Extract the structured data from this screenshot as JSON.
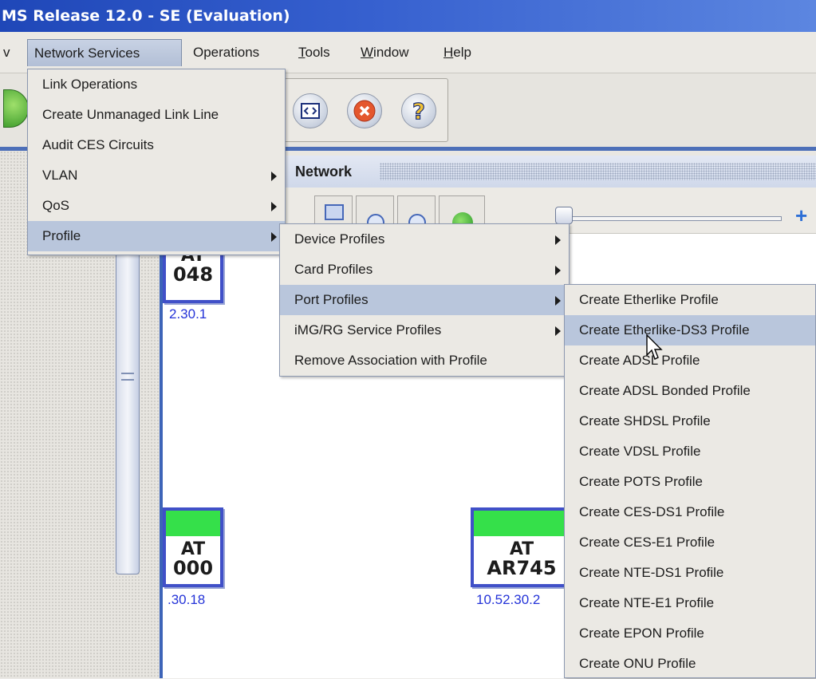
{
  "window": {
    "title": "MS Release 12.0 - SE (Evaluation)"
  },
  "menubar": {
    "items": [
      {
        "label": "v"
      },
      {
        "label": "Network Services"
      },
      {
        "label": "Operations"
      },
      {
        "label": "Tools"
      },
      {
        "label": "Window"
      },
      {
        "label": "Help"
      }
    ]
  },
  "network_panel": {
    "title": "Network"
  },
  "devices": [
    {
      "line1": "AT",
      "line2": "048",
      "ip": "2.30.1"
    },
    {
      "line1": "AT",
      "line2": "000",
      "ip": ".30.18"
    },
    {
      "line1": "AT",
      "line2": "AR745",
      "ip": "10.52.30.2"
    }
  ],
  "network_services_menu": {
    "items": [
      {
        "label": "Link Operations",
        "submenu": false
      },
      {
        "label": "Create Unmanaged Link Line",
        "submenu": false
      },
      {
        "label": "Audit CES Circuits",
        "submenu": false
      },
      {
        "label": "VLAN",
        "submenu": true
      },
      {
        "label": "QoS",
        "submenu": true
      },
      {
        "label": "Profile",
        "submenu": true,
        "selected": true
      }
    ]
  },
  "profile_menu": {
    "items": [
      {
        "label": "Device Profiles",
        "submenu": true
      },
      {
        "label": "Card Profiles",
        "submenu": true
      },
      {
        "label": "Port Profiles",
        "submenu": true,
        "selected": true
      },
      {
        "label": "iMG/RG Service Profiles",
        "submenu": true
      },
      {
        "label": "Remove Association with Profile",
        "submenu": false
      }
    ]
  },
  "port_profiles_menu": {
    "items": [
      {
        "label": "Create Etherlike Profile"
      },
      {
        "label": "Create Etherlike-DS3 Profile",
        "selected": true
      },
      {
        "label": "Create ADSL Profile"
      },
      {
        "label": "Create ADSL Bonded Profile"
      },
      {
        "label": "Create SHDSL Profile"
      },
      {
        "label": "Create VDSL Profile"
      },
      {
        "label": "Create POTS Profile"
      },
      {
        "label": "Create CES-DS1 Profile"
      },
      {
        "label": "Create CES-E1 Profile"
      },
      {
        "label": "Create NTE-DS1 Profile"
      },
      {
        "label": "Create NTE-E1 Profile"
      },
      {
        "label": "Create EPON Profile"
      },
      {
        "label": "Create ONU Profile"
      }
    ]
  },
  "toolbar": {
    "icons": [
      "refresh-icon",
      "console-icon",
      "stop-icon",
      "help-icon"
    ]
  },
  "colors": {
    "title_bar": "#1f47b8",
    "menu_selection": "#b9c6dc",
    "device_border": "#4050c8",
    "device_status": "#35e04a",
    "ip_text": "#2433d8"
  }
}
